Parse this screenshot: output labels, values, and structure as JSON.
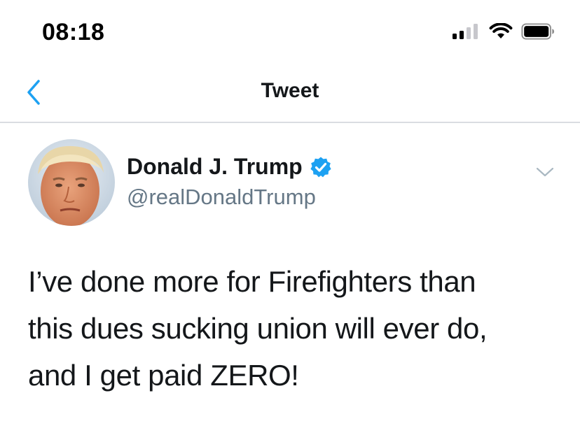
{
  "status_bar": {
    "time": "08:18",
    "signal_icon": "cellular-signal-icon",
    "wifi_icon": "wifi-icon",
    "battery_icon": "battery-icon"
  },
  "nav": {
    "back_icon": "chevron-left-icon",
    "title": "Tweet"
  },
  "tweet": {
    "author": {
      "display_name": "Donald J. Trump",
      "handle": "@realDonaldTrump",
      "verified": true,
      "verified_icon": "verified-badge-icon"
    },
    "menu_icon": "chevron-down-icon",
    "text_lines": [
      "I’ve done more for Firefighters than",
      "this dues sucking union will ever do,",
      "and I get paid ZERO!"
    ]
  },
  "colors": {
    "accent": "#1da1f2",
    "text_primary": "#14171a",
    "text_secondary": "#657786",
    "divider": "#dadde1"
  }
}
